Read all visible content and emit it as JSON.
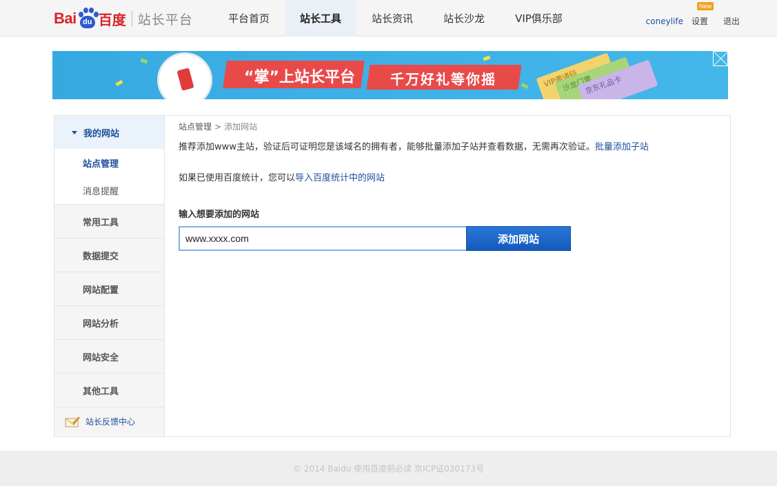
{
  "header": {
    "logo_latin_left": "Bai",
    "logo_paw_text": "du",
    "logo_chinese": "百度",
    "logo_subtitle": "站长平台",
    "nav": [
      {
        "label": "平台首页"
      },
      {
        "label": "站长工具"
      },
      {
        "label": "站长资讯"
      },
      {
        "label": "站长沙龙"
      },
      {
        "label": "VIP俱乐部"
      }
    ],
    "active_nav": "站长工具",
    "username": "coneylife",
    "settings_label": "设置",
    "settings_badge": "New",
    "logout_label": "退出"
  },
  "banner": {
    "text_left": "“掌”上站长平台",
    "text_right": "千万好礼等你摇",
    "tickets": [
      "VIP邀请码",
      "沙龙门票",
      "京东礼品卡"
    ]
  },
  "sidebar": {
    "section_title": "我的网站",
    "sub_items": [
      {
        "label": "站点管理",
        "active": true
      },
      {
        "label": "消息提醒",
        "active": false
      }
    ],
    "groups": [
      {
        "label": "常用工具"
      },
      {
        "label": "数据提交"
      },
      {
        "label": "网站配置"
      },
      {
        "label": "网站分析"
      },
      {
        "label": "网站安全"
      },
      {
        "label": "其他工具"
      }
    ],
    "feedback_label": "站长反馈中心"
  },
  "content": {
    "breadcrumb": {
      "parent": "站点管理",
      "separator": ">",
      "current": "添加网站"
    },
    "tip1_text": "推荐添加www主站，验证后可证明您是该域名的拥有者，能够批量添加子站并查看数据，无需再次验证。",
    "tip1_link": "批量添加子站",
    "tip2_text": "如果已使用百度统计，您可以",
    "tip2_link": "导入百度统计中的网站",
    "form_label": "输入想要添加的网站",
    "site_input_value": "www.xxxx.com",
    "add_button_label": "添加网站"
  },
  "footer": {
    "text": "© 2014 Baidu 使用百度前必读 京ICP证030173号"
  },
  "colors": {
    "brand_red": "#d8232a",
    "brand_blue": "#2d5bce",
    "link_blue": "#1d4e9b",
    "button_blue": "#1f66c9",
    "banner_blue": "#3cb0e6"
  }
}
